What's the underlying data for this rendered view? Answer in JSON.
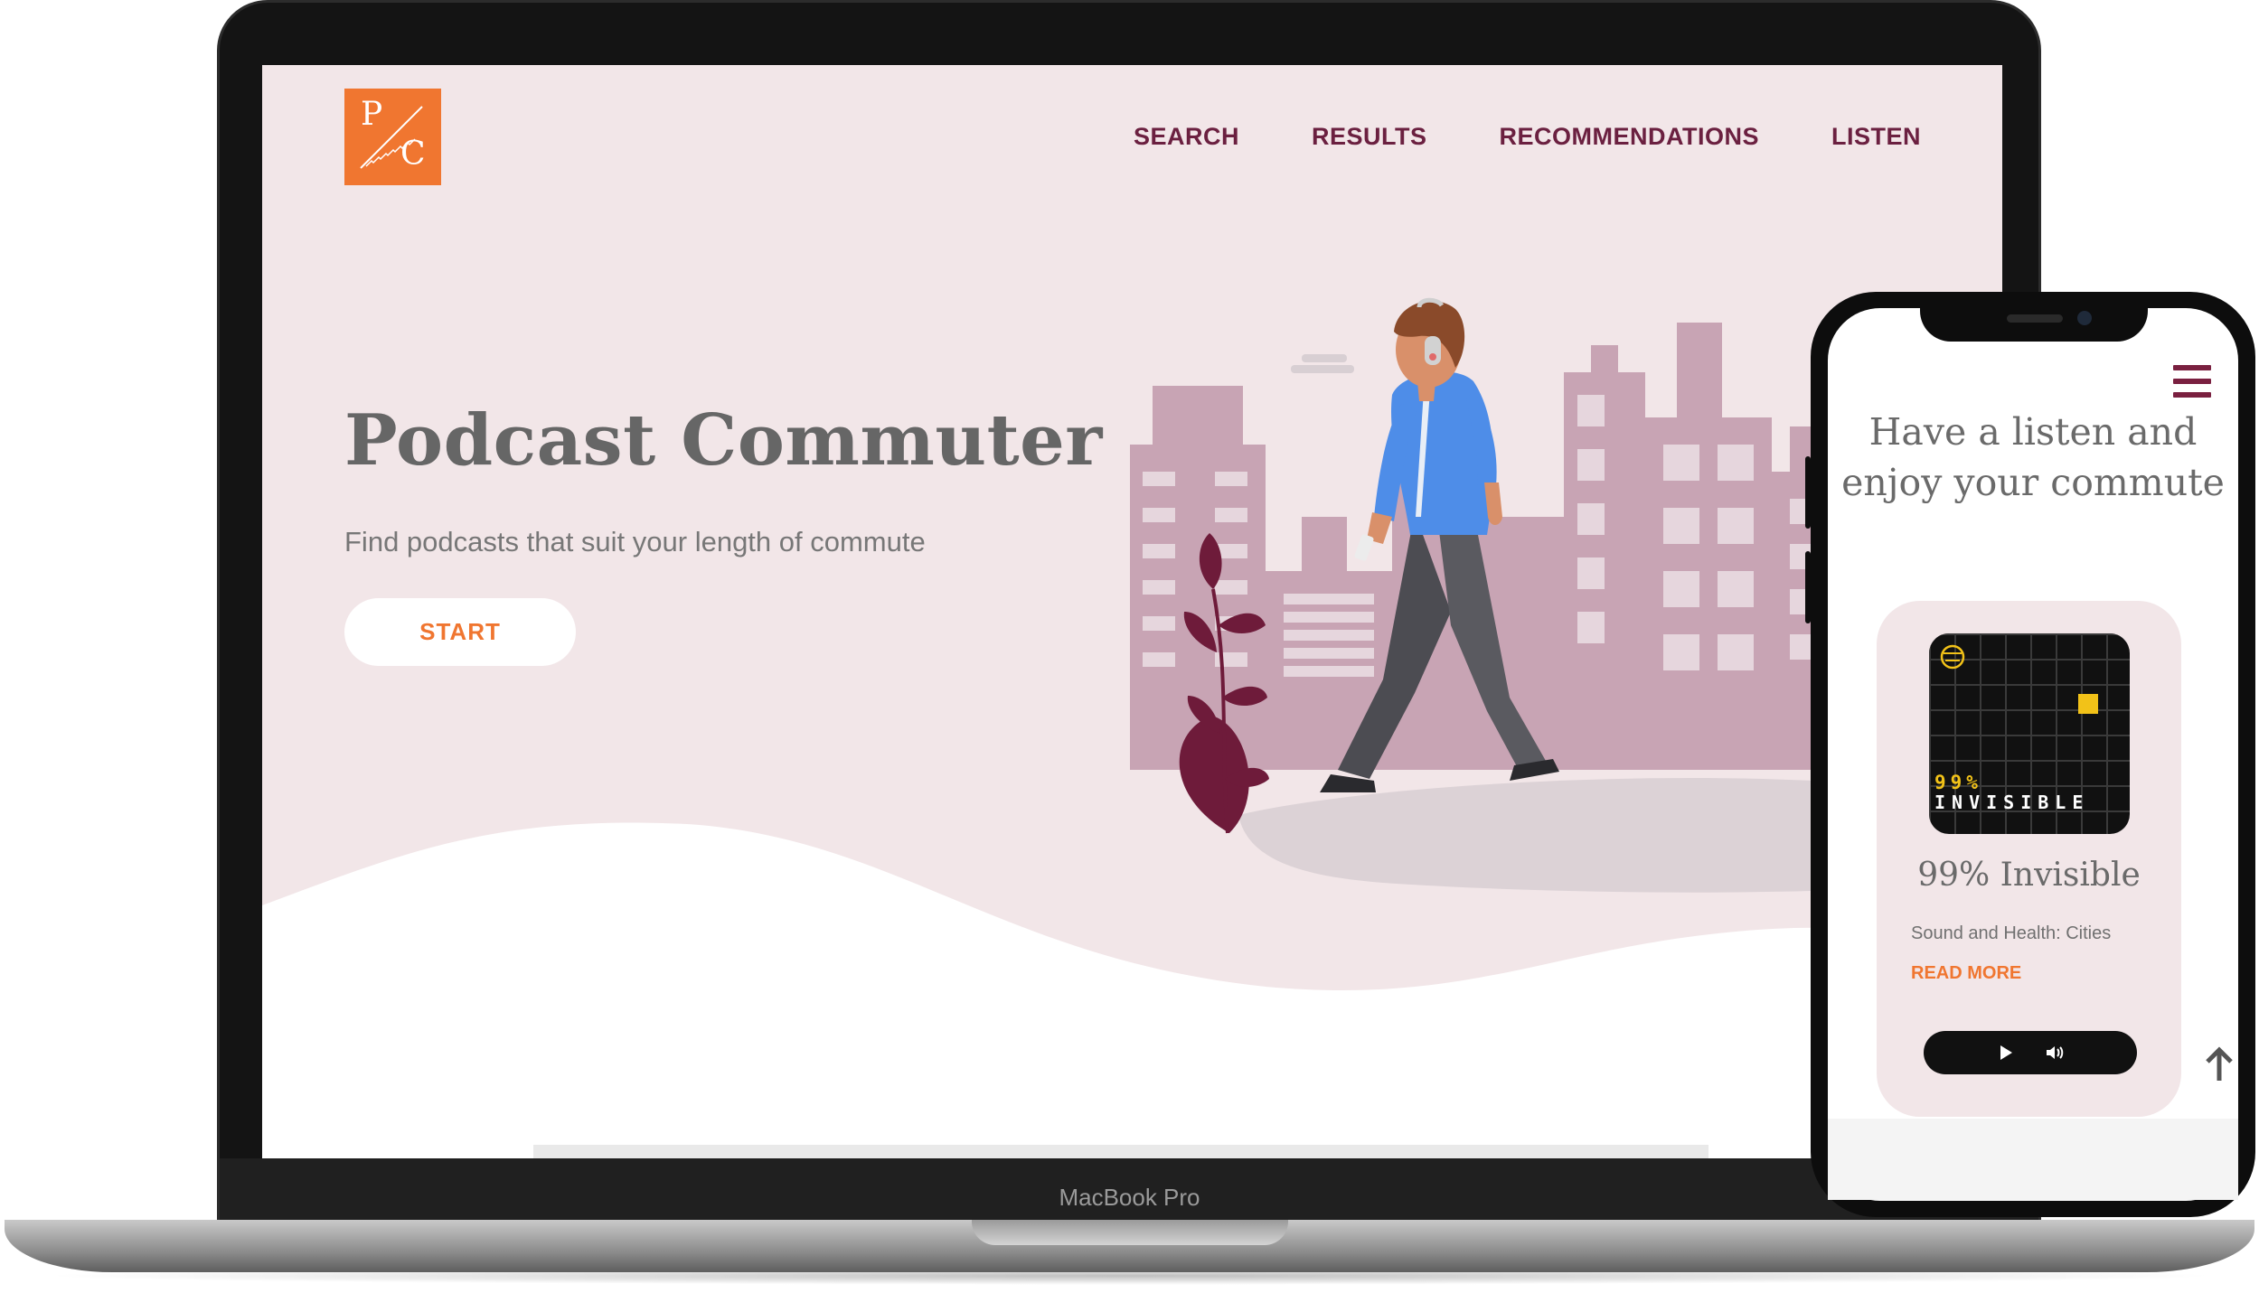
{
  "laptop": {
    "label": "MacBook Pro",
    "header": {
      "logo": {
        "letter_top": "P",
        "letter_bottom": "C",
        "color": "#f07630"
      },
      "nav": [
        {
          "label": "SEARCH"
        },
        {
          "label": "RESULTS"
        },
        {
          "label": "RECOMMENDATIONS"
        },
        {
          "label": "LISTEN"
        }
      ]
    },
    "hero": {
      "title": "Podcast Commuter",
      "subtitle": "Find podcasts that suit your length of commute",
      "cta_label": "START"
    }
  },
  "phone": {
    "heading": "Have a listen and enjoy your commute",
    "card": {
      "artwork": {
        "percent_text": "99%",
        "word_text": "INVISIBLE"
      },
      "title": "99% Invisible",
      "description": "Sound and Health: Cities",
      "link_label": "READ MORE"
    },
    "icons": {
      "menu": "hamburger-menu-icon",
      "play": "play-icon",
      "volume": "volume-icon",
      "scroll_top": "arrow-up-icon"
    }
  },
  "colors": {
    "accent_orange": "#f07630",
    "nav_maroon": "#6b2040",
    "page_pink": "#f2e6e8",
    "building_mauve": "#c8a4b4",
    "leaf_maroon": "#6e1b3a"
  }
}
